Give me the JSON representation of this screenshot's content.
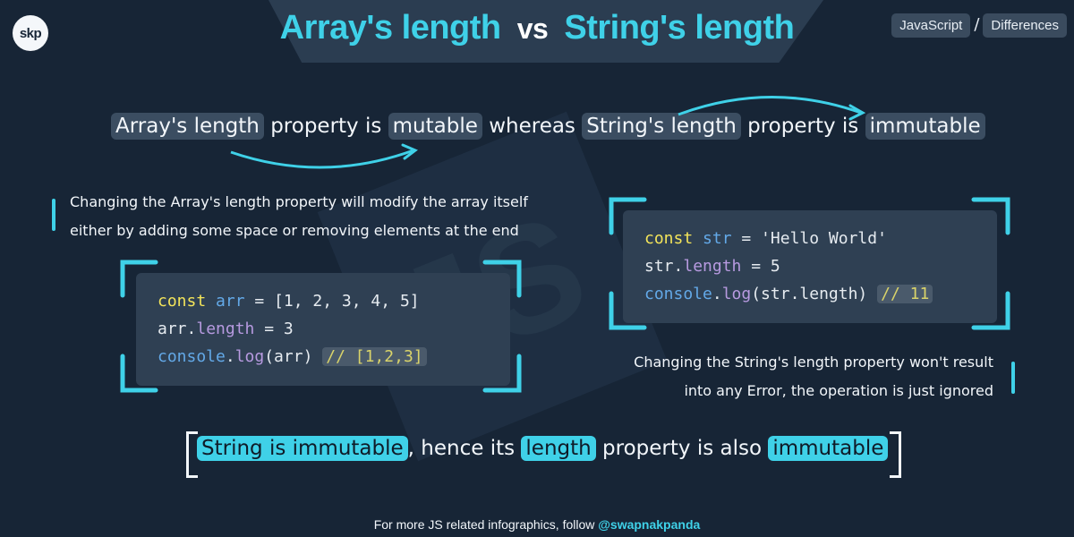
{
  "logo": "skp",
  "header": {
    "title_part1": "Array's length",
    "vs": "vs",
    "title_part2": "String's length"
  },
  "tags": [
    "JavaScript",
    "Differences"
  ],
  "watermark": "JS",
  "statement": {
    "p1": "Array's length",
    "p2": " property is ",
    "p3": "mutable",
    "p4": " whereas ",
    "p5": "String's length",
    "p6": " property is ",
    "p7": "immutable"
  },
  "note_left": {
    "line1": "Changing the Array's length property will modify the array itself",
    "line2": "either by adding some space or removing elements at the end"
  },
  "note_right": {
    "line1": "Changing the String's length property won't result",
    "line2": "into any Error, the operation is just ignored"
  },
  "code_left": {
    "l1_kw": "const",
    "l1_var": "arr",
    "l1_rest": " = [1, 2, 3, 4, 5]",
    "l2_obj": "arr",
    "l2_dot": ".",
    "l2_prop": "length",
    "l2_rest": " = 3",
    "l3_obj": "console",
    "l3_dot": ".",
    "l3_fn": "log",
    "l3_rest": "(arr) ",
    "l3_comment": "// [1,2,3]"
  },
  "code_right": {
    "l1_kw": "const",
    "l1_var": "str",
    "l1_rest": " = 'Hello World'",
    "l2_obj": "str",
    "l2_dot": ".",
    "l2_prop": "length",
    "l2_rest": " = 5",
    "l3_obj": "console",
    "l3_dot": ".",
    "l3_fn": "log",
    "l3_rest": "(str.length) ",
    "l3_comment": "// 11"
  },
  "conclusion": {
    "c1": "String is immutable",
    "c2": ", hence its ",
    "c3": "length",
    "c4": " property is also ",
    "c5": "immutable"
  },
  "footer": {
    "text": "For more JS related infographics, follow ",
    "handle": "@swapnakpanda"
  },
  "colors": {
    "background": "#172536",
    "accent": "#3fd1e8",
    "highlight": "#3b4d61",
    "code_bg": "#2f4053"
  }
}
